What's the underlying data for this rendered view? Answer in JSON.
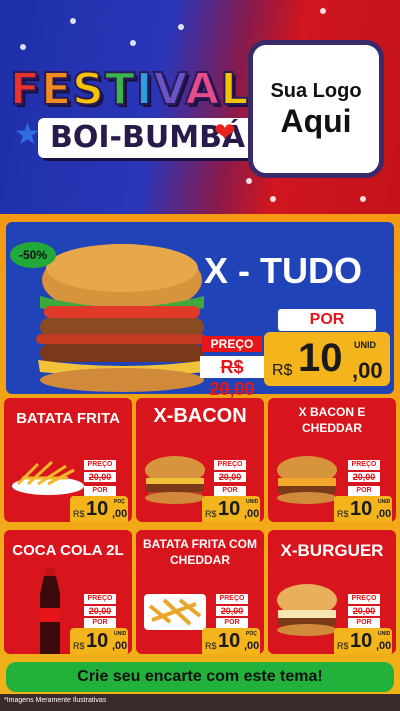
{
  "header": {
    "festival": "FESTIVAL",
    "boi_bumba": "BOI-BUMBÁ",
    "logo_line1": "Sua Logo",
    "logo_line2": "Aqui"
  },
  "featured": {
    "discount": "-50%",
    "name": "X - TUDO",
    "preco_label": "PREÇO",
    "old_price": "R$ 20,00",
    "por_label": "POR",
    "currency": "R$",
    "price_int": "10",
    "price_dec": ",00",
    "unit": "UNID"
  },
  "items": [
    {
      "title": "BATATA FRITA",
      "preco_label": "PREÇO",
      "old_price": "20,00",
      "por_label": "POR",
      "currency": "R$",
      "price_int": "10",
      "price_dec": ",00",
      "unit": "POÇ"
    },
    {
      "title": "X-BACON",
      "preco_label": "PREÇO",
      "old_price": "20,00",
      "por_label": "POR",
      "currency": "R$",
      "price_int": "10",
      "price_dec": ",00",
      "unit": "UNID"
    },
    {
      "title": "X BACON E CHEDDAR",
      "preco_label": "PREÇO",
      "old_price": "20,00",
      "por_label": "POR",
      "currency": "R$",
      "price_int": "10",
      "price_dec": ",00",
      "unit": "UNID"
    },
    {
      "title": "COCA COLA 2L",
      "preco_label": "PREÇO",
      "old_price": "20,00",
      "por_label": "POR",
      "currency": "R$",
      "price_int": "10",
      "price_dec": ",00",
      "unit": "UNID"
    },
    {
      "title": "BATATA FRITA COM CHEDDAR",
      "preco_label": "PREÇO",
      "old_price": "20,00",
      "por_label": "POR",
      "currency": "R$",
      "price_int": "10",
      "price_dec": ",00",
      "unit": "POÇ"
    },
    {
      "title": "X-BURGUER",
      "preco_label": "PREÇO",
      "old_price": "20,00",
      "por_label": "POR",
      "currency": "R$",
      "price_int": "10",
      "price_dec": ",00",
      "unit": "UNID"
    }
  ],
  "cta": "Crie seu encarte com este tema!",
  "disclaimer": "*Imagens Meramente Ilustrativas",
  "colors": {
    "red": "#d8141c",
    "blue": "#2043b8",
    "orange": "#f39a12",
    "yellow": "#f4b51c",
    "green": "#22b13a"
  }
}
